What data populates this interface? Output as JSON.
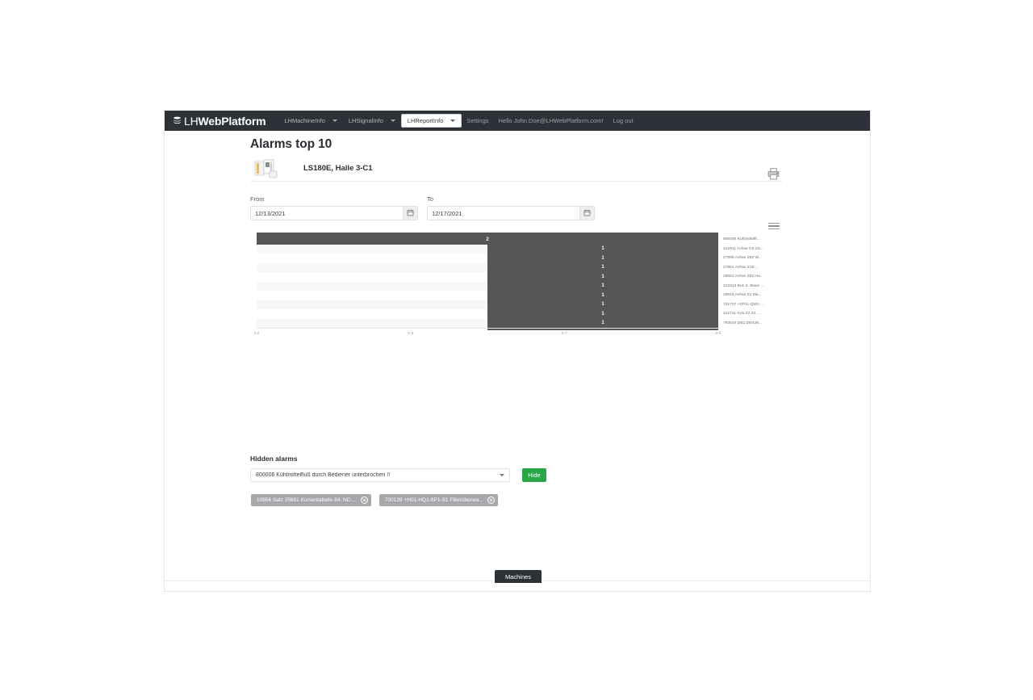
{
  "navbar": {
    "brand_lh": "LH",
    "brand_web": "WebPlatform",
    "brand_icon": "layers-icon",
    "items": [
      {
        "label": "LHMachineInfo",
        "has_caret": true,
        "active": false
      },
      {
        "label": "LHSignalInfo",
        "has_caret": true,
        "active": false
      },
      {
        "label": "LHReportInfo",
        "has_caret": true,
        "active": true
      }
    ],
    "settings_label": "Settings",
    "greeting": "Hello John.Doe@LHWebPlatform.com!",
    "logout_label": "Log out"
  },
  "page": {
    "title": "Alarms top 10",
    "machine_name": "LS180E, Halle 3-C1",
    "machine_icon": "machine-icon",
    "print_icon": "printer-icon"
  },
  "filters": {
    "from_label": "From",
    "from_value": "12/13/2021",
    "to_label": "To",
    "to_value": "12/17/2021",
    "calendar_icon": "calendar-icon"
  },
  "chart_menu_icon": "hamburger-menu-icon",
  "chart_data": {
    "type": "bar",
    "orientation": "horizontal",
    "title": "Alarms top 10",
    "xlabel": "",
    "ylabel": "",
    "xlim": [
      2.0,
      0.0
    ],
    "reversed_x_axis": true,
    "grid": false,
    "legend": false,
    "bar_color": "#565656",
    "x_ticks": [
      "2.0",
      "1.3",
      "0.7",
      "0.0"
    ],
    "categories": [
      "800006 Kühlmittelfl...",
      "221911 Achse C6 C6...",
      "27006 Achse Z82 W...",
      "27001 Achse Z18...",
      "28001 Achse Z82 Ha...",
      "221913 Bus 3. Slave ...",
      "28019 Achse Z1 Ma...",
      "701737 +SP11-QM1-...",
      "221711 Axis Z2 Z2 ...",
      "792034 DB2.DBX36..."
    ],
    "values": [
      2,
      1,
      1,
      1,
      1,
      1,
      1,
      1,
      1,
      1
    ],
    "data_labels": [
      "2",
      "1",
      "1",
      "1",
      "1",
      "1",
      "1",
      "1",
      "1",
      "1"
    ]
  },
  "hidden_alarms": {
    "title": "Hidden alarms",
    "selected": "800006 Kühlmittelfluß durch Bediener unterbrochen !!",
    "hide_button": "Hide",
    "caret_icon": "chevron-down-icon",
    "tags": [
      {
        "text": "10956 Satz 25691 Kurventabelle 84: NC-...",
        "close_icon": "close-circle-icon"
      },
      {
        "text": "700139 +H01-HQ1-8P1-S1 Filterüberwa...",
        "close_icon": "close-circle-icon"
      }
    ]
  },
  "footer": {
    "machines_label": "Machines"
  }
}
